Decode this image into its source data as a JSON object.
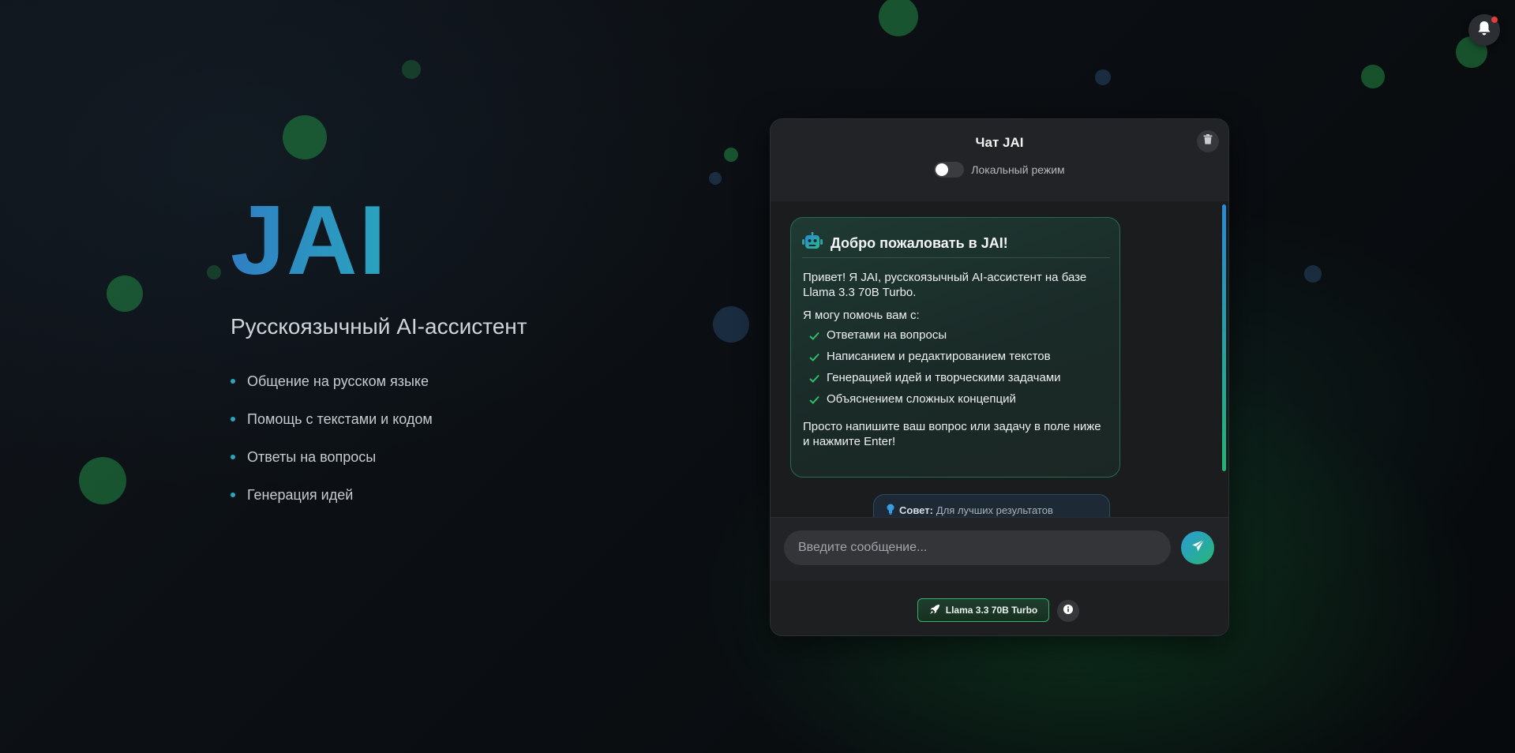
{
  "hero": {
    "logo": "JAI",
    "subtitle": "Русскоязычный AI-ассистент",
    "features": [
      "Общение на русском языке",
      "Помощь с текстами и кодом",
      "Ответы на вопросы",
      "Генерация идей"
    ]
  },
  "chat": {
    "title": "Чат JAI",
    "mode_label": "Локальный режим",
    "mode_enabled": false,
    "welcome": {
      "title": "Добро пожаловать в JAI!",
      "intro": "Привет! Я JAI, русскоязычный AI-ассистент на базе Llama 3.3 70B Turbo.",
      "can_help": "Я могу помочь вам с:",
      "items": [
        "Ответами на вопросы",
        "Написанием и редактированием текстов",
        "Генерацией идей и творческими задачами",
        "Объяснением сложных концепций"
      ],
      "outro": "Просто напишите ваш вопрос или задачу в поле ниже и нажмите Enter!"
    },
    "tip": {
      "label": "Совет:",
      "text": "Для лучших результатов"
    },
    "input": {
      "placeholder": "Введите сообщение...",
      "value": ""
    },
    "model_label": "Llama 3.3 70B Turbo"
  },
  "icons": {
    "notification": "bell-icon",
    "clear": "trash-icon",
    "bot": "robot-icon",
    "check": "check-icon",
    "tip": "lightbulb-icon",
    "send": "paper-plane-icon",
    "model": "rocket-icon",
    "info": "info-icon"
  },
  "colors": {
    "accent_blue": "#2a8ad6",
    "accent_green": "#22b573",
    "notification_badge": "#e23c3c"
  }
}
